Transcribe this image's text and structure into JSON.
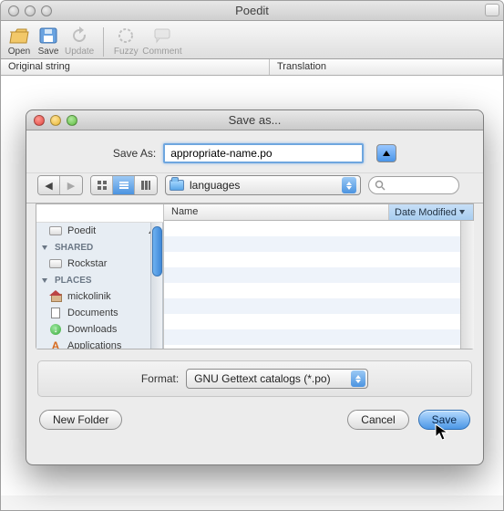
{
  "mainWindow": {
    "title": "Poedit",
    "toolbar": {
      "open": "Open",
      "save": "Save",
      "update": "Update",
      "fuzzy": "Fuzzy",
      "comment": "Comment"
    },
    "columns": {
      "original": "Original string",
      "translation": "Translation"
    }
  },
  "dialog": {
    "title": "Save as...",
    "saveAsLabel": "Save As:",
    "fileName": "appropriate-name.po",
    "folder": "languages",
    "searchPlaceholder": "",
    "listHeaders": {
      "name": "Name",
      "date": "Date Modified"
    },
    "sidebar": {
      "deviceItem": "Poedit",
      "sharedLabel": "Shared",
      "sharedItem": "Rockstar",
      "placesLabel": "Places",
      "places": {
        "home": "mickolinik",
        "documents": "Documents",
        "downloads": "Downloads",
        "applications": "Applications"
      }
    },
    "formatLabel": "Format:",
    "formatValue": "GNU Gettext catalogs (*.po)",
    "buttons": {
      "newFolder": "New Folder",
      "cancel": "Cancel",
      "save": "Save"
    }
  }
}
